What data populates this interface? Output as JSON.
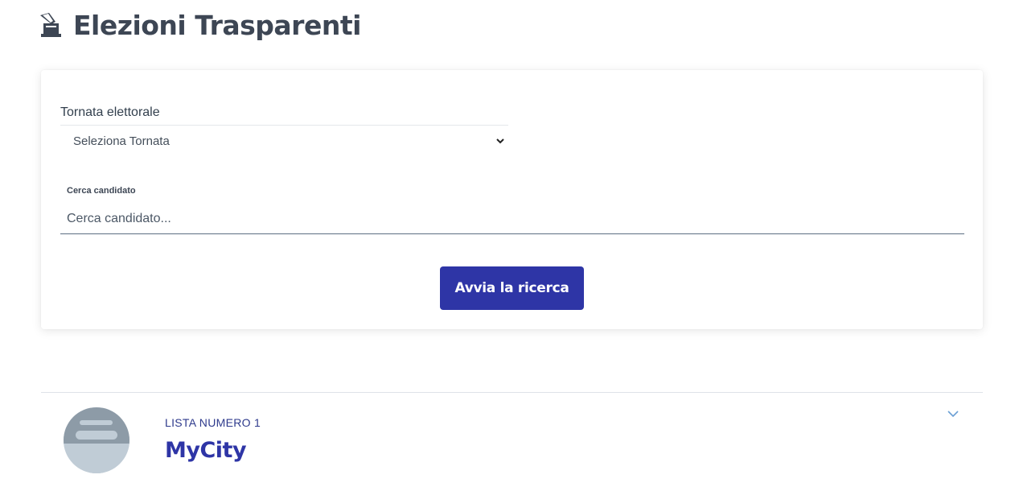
{
  "header": {
    "title": "Elezioni Trasparenti",
    "icon": "ballot-box-icon"
  },
  "search_form": {
    "select_label": "Tornata elettorale",
    "select_value": "Seleziona Tornata",
    "search_label": "Cerca candidato",
    "search_placeholder": "Cerca candidato...",
    "search_value": "",
    "button_label": "Avvia la ricerca"
  },
  "lists": [
    {
      "number_label": "LISTA NUMERO 1",
      "name": "MyCity",
      "avatar_icon": "list-logo-placeholder-icon",
      "expand_icon": "chevron-down-icon"
    }
  ],
  "colors": {
    "primary": "#2e35a6",
    "title_text": "#3d4654",
    "link_blue": "#2e3a8c"
  }
}
